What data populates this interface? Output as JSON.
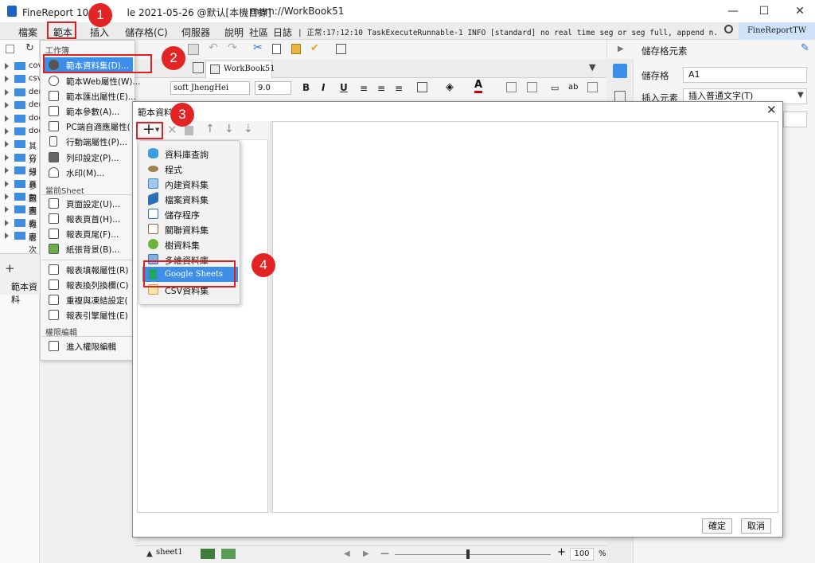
{
  "window": {
    "app_title": "FineReport 10.0 st",
    "app_title_rest": "le 2021-05-26 @默认[本機目錄]",
    "path": "mem://WorkBook51",
    "minimize": "—",
    "maximize": "☐",
    "close": "✕"
  },
  "menubar": {
    "items": [
      "檔案",
      "範本",
      "插入",
      "儲存格(C)",
      "伺服器",
      "說明",
      "社區",
      "日誌"
    ],
    "log_text": "| 正常:17:12:10 TaskExecuteRunnable-1 INFO [standard] no real time seg or seg full, append n...",
    "right_tab": "FineReportTW"
  },
  "left_tree": {
    "items": [
      "cov",
      "csv",
      "dem",
      "dem",
      "doc",
      "doc",
      "其它",
      "分組",
      "分頁",
      "參數",
      "圖表",
      "圖表",
      "報表",
      "層次"
    ],
    "bottom_label": "範本資料"
  },
  "template_menu": {
    "section_workbook": "工作簿",
    "items_workbook": [
      "範本資料集(D)...",
      "範本Web屬性(W)...",
      "範本匯出屬性(E)...",
      "範本參數(A)...",
      "PC端自適應屬性(",
      "行動端屬性(P)...",
      "列印設定(P)...",
      "水印(M)..."
    ],
    "section_sheet": "當前Sheet",
    "items_sheet": [
      "頁面設定(U)...",
      "報表頁首(H)...",
      "報表頁尾(F)...",
      "紙張背景(B)..."
    ],
    "items_sheet2": [
      "報表填報屬性(R)",
      "報表換列換欄(C)",
      "重複與凍結設定(",
      "報表引擎屬性(E)"
    ],
    "section_auth": "權限編輯",
    "item_auth": "進入權限編輯"
  },
  "editor": {
    "tab_label": "WorkBook51",
    "font_name": "soft JhengHei",
    "font_size": "9.0",
    "bold": "B",
    "italic": "I",
    "underline": "U",
    "sheet_tab": "sheet1",
    "zoom": "100",
    "zoom_unit": "%",
    "zoom_minus": "—",
    "zoom_plus": "+"
  },
  "right_panel": {
    "title": "儲存格元素",
    "cell_label": "儲存格",
    "cell_value": "A1",
    "insert_label": "插入元素",
    "insert_value": "插入普通文字(T)"
  },
  "dialog": {
    "title": "範本資料集",
    "close": "✕",
    "ok": "確定",
    "cancel": "取消",
    "add_symbol": "+"
  },
  "add_menu": {
    "items": [
      "資料庫查詢",
      "程式",
      "內建資料集",
      "檔案資料集",
      "儲存程序",
      "關聯資料集",
      "樹資料集",
      "多維資料庫",
      "Google Sheets",
      "CSV資料集"
    ]
  },
  "callouts": [
    "1",
    "2",
    "3",
    "4"
  ],
  "colors": {
    "accent": "#3d8ee8",
    "callout": "#e22424",
    "highlight": "#e02020",
    "folder": "#3f8de0"
  }
}
